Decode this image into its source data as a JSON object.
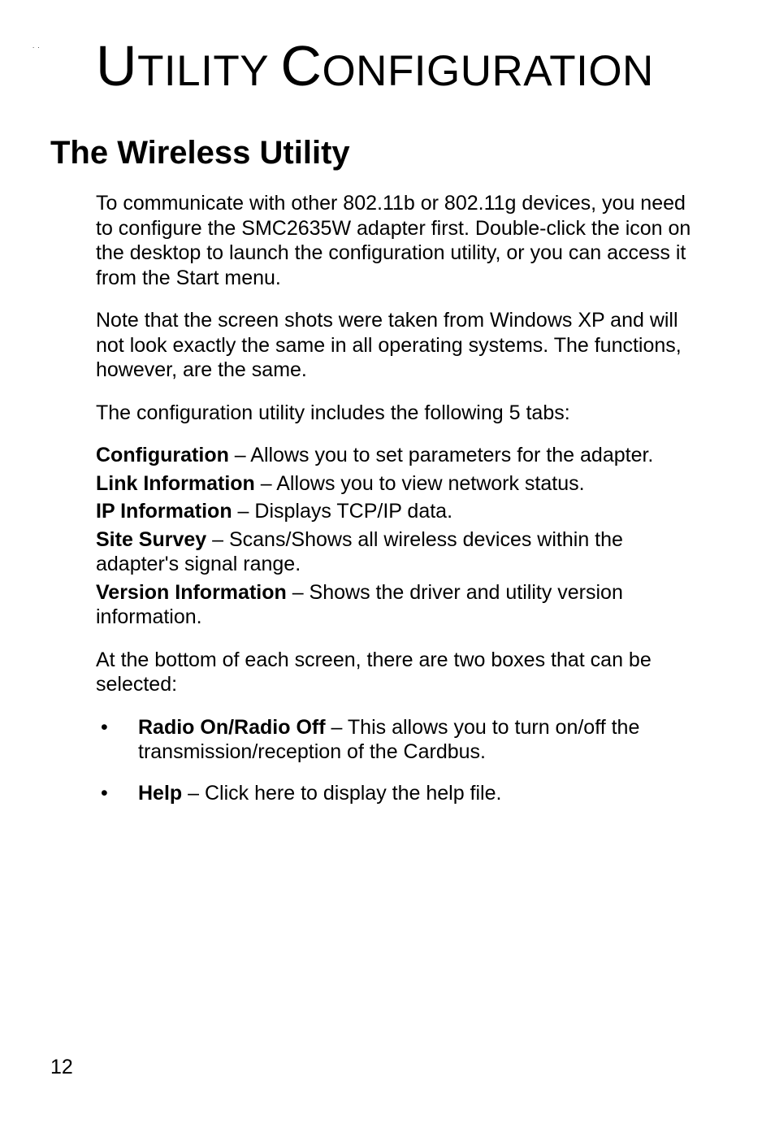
{
  "chapter": {
    "marker": ". .",
    "title_parts": [
      "U",
      "TILITY",
      " ",
      "C",
      "ONFIGURATION"
    ]
  },
  "section": {
    "title": "The Wireless Utility"
  },
  "paragraphs": {
    "intro1": "To communicate with other 802.11b or 802.11g devices, you need to configure the SMC2635W adapter first. Double-click the icon on the desktop to launch the configuration utility, or you can access it from the Start menu.",
    "intro2": "Note that the screen shots were taken from Windows XP and will not look exactly the same in all operating systems. The functions, however, are the same.",
    "tabs_lead": "The configuration utility includes the following 5 tabs:",
    "tabs": [
      {
        "label": "Configuration",
        "desc": " – Allows you to set parameters for the adapter."
      },
      {
        "label": "Link Information",
        "desc": " – Allows you to view network status."
      },
      {
        "label": "IP Information",
        "desc": " – Displays TCP/IP data."
      },
      {
        "label": "Site Survey",
        "desc": " – Scans/Shows all wireless devices within the adapter's signal range."
      },
      {
        "label": "Version Information",
        "desc": " – Shows the driver and utility version information."
      }
    ],
    "boxes_lead": "At the bottom of each screen, there are two boxes that can be selected:",
    "bullets": [
      {
        "label": "Radio On/Radio Off",
        "desc": " – This allows you to turn on/off the transmission/reception of the Cardbus."
      },
      {
        "label": "Help",
        "desc": " – Click here to display the help file."
      }
    ]
  },
  "page_number": "12"
}
